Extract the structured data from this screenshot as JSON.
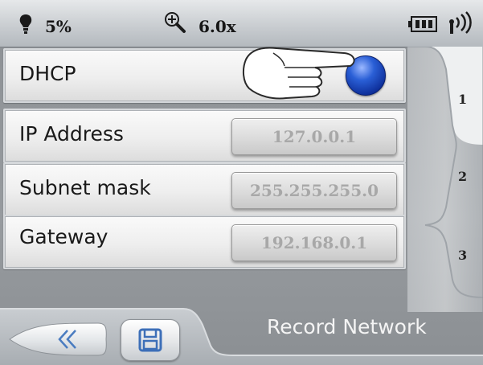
{
  "status": {
    "battery_icon": "bulb-icon",
    "brightness": "5%",
    "zoom_icon": "zoom-in-icon",
    "zoom": "6.0x",
    "battery_level_icon": "battery-icon",
    "signal_icon": "signal-icon"
  },
  "rows": {
    "dhcp": {
      "label": "DHCP",
      "toggle_on": true,
      "toggle_color": "#1f4fd0"
    },
    "ip": {
      "label": "IP Address",
      "value": "127.0.0.1"
    },
    "subnet": {
      "label": "Subnet mask",
      "value": "255.255.255.0"
    },
    "gateway": {
      "label": "Gateway",
      "value": "192.168.0.1"
    }
  },
  "tabs": [
    {
      "label": "1",
      "active": true
    },
    {
      "label": "2",
      "active": false
    },
    {
      "label": "3",
      "active": false
    }
  ],
  "footer": {
    "back_icon": "double-chevron-left-icon",
    "save_icon": "floppy-disk-icon",
    "title": "Record Network"
  },
  "overlay": {
    "icon": "pointing-hand-icon"
  }
}
